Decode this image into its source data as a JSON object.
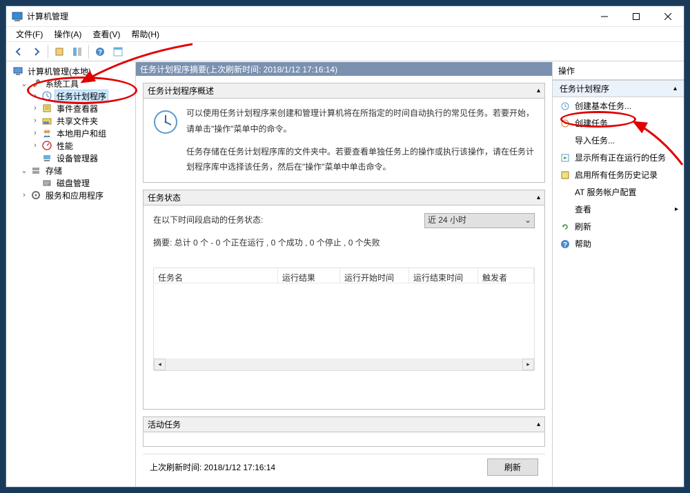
{
  "window": {
    "title": "计算机管理"
  },
  "menu": {
    "file": "文件(F)",
    "action": "操作(A)",
    "view": "查看(V)",
    "help": "帮助(H)"
  },
  "tree": {
    "root": "计算机管理(本地)",
    "system_tools": "系统工具",
    "task_scheduler": "任务计划程序",
    "event_viewer": "事件查看器",
    "shared_folders": "共享文件夹",
    "local_users": "本地用户和组",
    "performance": "性能",
    "device_manager": "设备管理器",
    "storage": "存储",
    "disk_management": "磁盘管理",
    "services_apps": "服务和应用程序"
  },
  "main": {
    "header": "任务计划程序摘要(上次刷新时间: 2018/1/12 17:16:14)",
    "overview_title": "任务计划程序概述",
    "overview_p1": "可以使用任务计划程序来创建和管理计算机将在所指定的时间自动执行的常见任务。若要开始，请单击\"操作\"菜单中的命令。",
    "overview_p2": "任务存储在任务计划程序库的文件夹中。若要查看单独任务上的操作或执行该操作，请在任务计划程序库中选择该任务，然后在\"操作\"菜单中单击命令。",
    "status_title": "任务状态",
    "status_period_label": "在以下时间段启动的任务状态:",
    "status_period_value": "近 24 小时",
    "status_summary": "摘要: 总计 0 个 - 0 个正在运行 , 0 个成功 , 0 个停止 , 0 个失败",
    "col_name": "任务名",
    "col_result": "运行结果",
    "col_start": "运行开始时间",
    "col_end": "运行结束时间",
    "col_trigger": "触发者",
    "active_title": "活动任务",
    "footer_label": "上次刷新时间: 2018/1/12 17:16:14",
    "refresh_btn": "刷新"
  },
  "actions": {
    "header": "操作",
    "section": "任务计划程序",
    "create_basic": "创建基本任务...",
    "create_task": "创建任务...",
    "import_task": "导入任务...",
    "show_running": "显示所有正在运行的任务",
    "enable_history": "启用所有任务历史记录",
    "at_config": "AT 服务帐户配置",
    "view": "查看",
    "refresh": "刷新",
    "help": "帮助"
  }
}
